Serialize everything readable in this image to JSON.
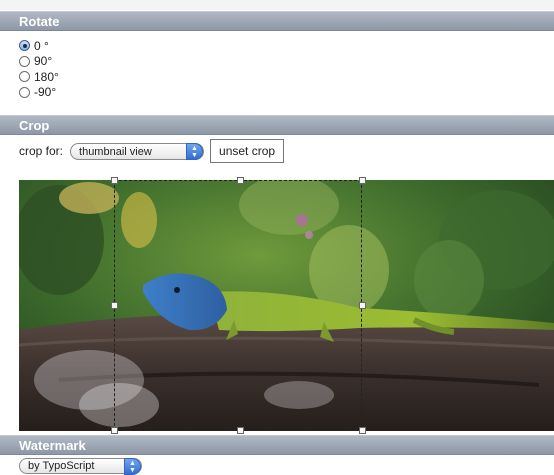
{
  "rotate": {
    "title": "Rotate",
    "options": [
      {
        "label": "0 °",
        "checked": true
      },
      {
        "label": "90°",
        "checked": false
      },
      {
        "label": "180°",
        "checked": false
      },
      {
        "label": "-90°",
        "checked": false
      }
    ]
  },
  "crop": {
    "title": "Crop",
    "crop_for_label": "crop for:",
    "crop_for_selected": "thumbnail view",
    "unset_button": "unset crop"
  },
  "watermark": {
    "title": "Watermark",
    "selected": "by TypoScript"
  },
  "colors": {
    "header_bg": "#9aa3b0",
    "accent": "#3b73d9"
  }
}
